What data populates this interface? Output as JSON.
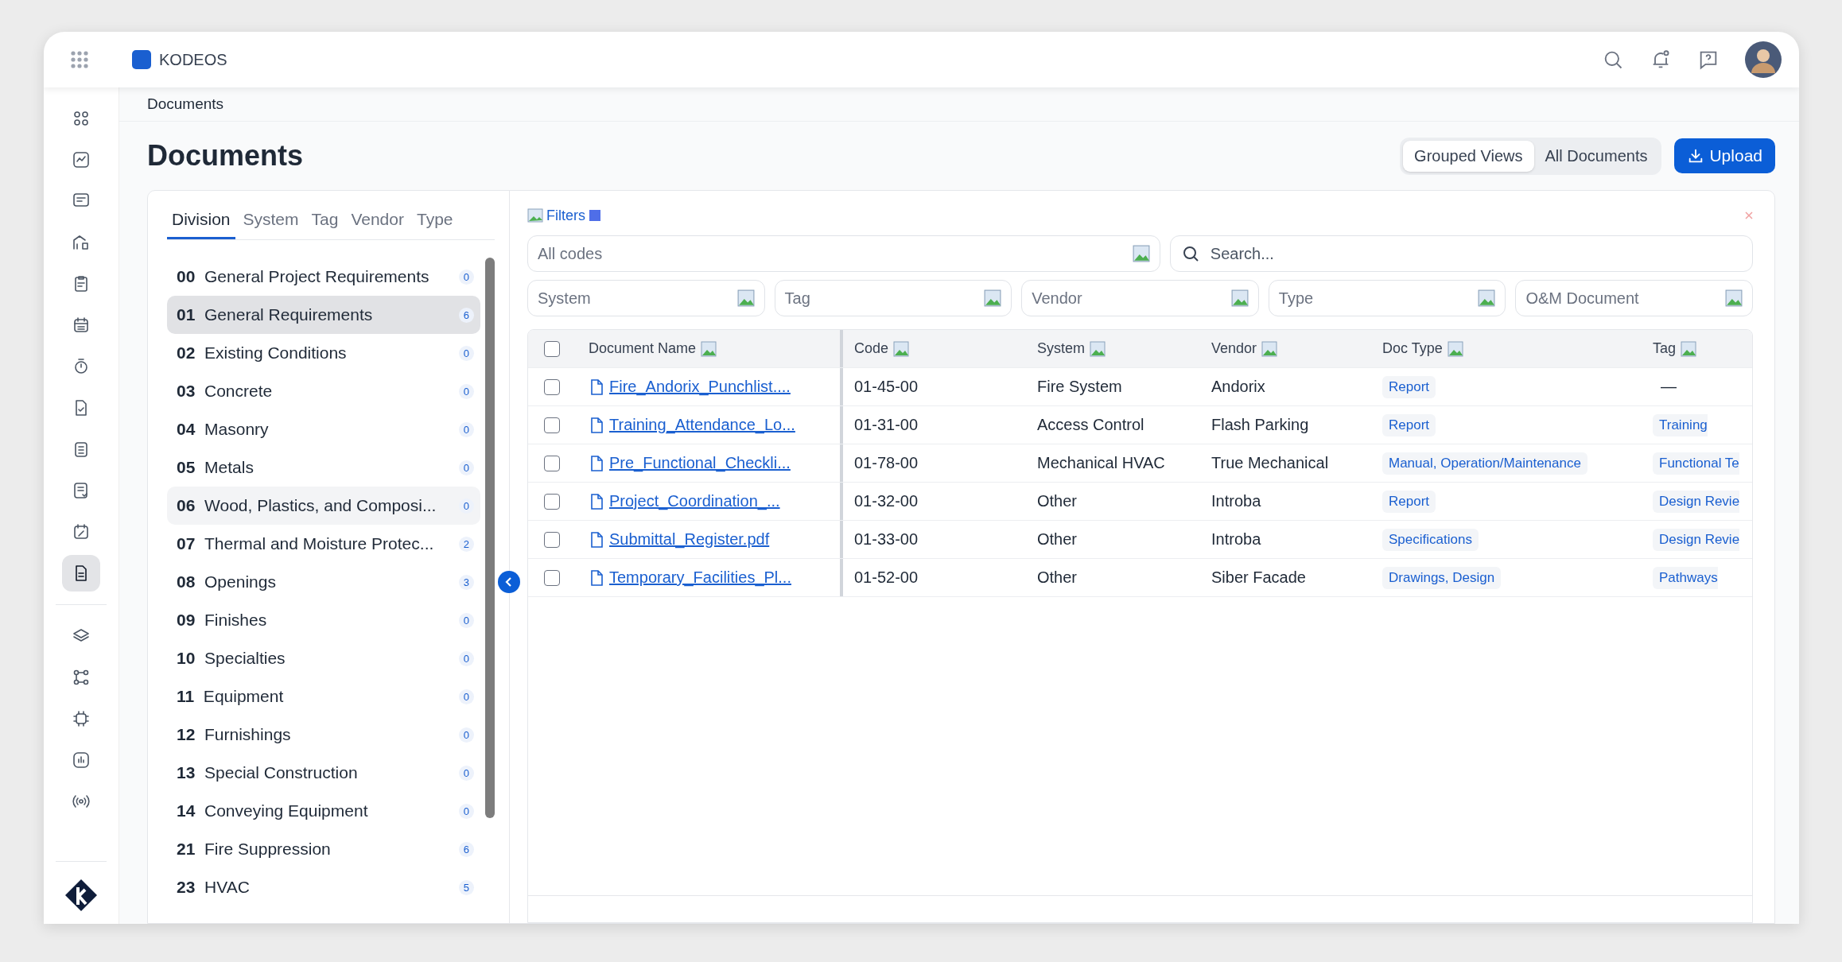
{
  "app": {
    "name": "KODEOS"
  },
  "rail": [
    {
      "kind": "grid",
      "selected": false
    },
    {
      "kind": "chart",
      "selected": false
    },
    {
      "kind": "chat",
      "selected": false
    },
    {
      "kind": "building",
      "selected": false
    },
    {
      "kind": "clipboard",
      "selected": false
    },
    {
      "kind": "calendar",
      "selected": false
    },
    {
      "kind": "timer",
      "selected": false
    },
    {
      "kind": "filecheck",
      "selected": false
    },
    {
      "kind": "list",
      "selected": false
    },
    {
      "kind": "notes",
      "selected": false
    },
    {
      "kind": "caledit",
      "selected": false
    },
    {
      "kind": "document",
      "selected": true
    }
  ],
  "rail_bottom": [
    {
      "kind": "layers",
      "selected": false
    },
    {
      "kind": "nodes",
      "selected": false
    },
    {
      "kind": "chip",
      "selected": false
    },
    {
      "kind": "bars",
      "selected": false
    },
    {
      "kind": "broadcast",
      "selected": false
    }
  ],
  "breadcrumb": "Documents",
  "title": "Documents",
  "view_toggle": [
    {
      "label": "Grouped Views",
      "selected": true
    },
    {
      "label": "All Documents",
      "selected": false
    }
  ],
  "upload": "Upload",
  "division_tabs": [
    {
      "label": "Division",
      "selected": true
    },
    {
      "label": "System",
      "selected": false
    },
    {
      "label": "Tag",
      "selected": false
    },
    {
      "label": "Vendor",
      "selected": false
    },
    {
      "label": "Type",
      "selected": false
    }
  ],
  "divisions": [
    {
      "code": "00",
      "name": "General Project Requirements",
      "count": "0",
      "selected": false,
      "hovered": false
    },
    {
      "code": "01",
      "name": "General Requirements",
      "count": "6",
      "selected": true,
      "hovered": false
    },
    {
      "code": "02",
      "name": "Existing Conditions",
      "count": "0",
      "selected": false,
      "hovered": false
    },
    {
      "code": "03",
      "name": "Concrete",
      "count": "0",
      "selected": false,
      "hovered": false
    },
    {
      "code": "04",
      "name": "Masonry",
      "count": "0",
      "selected": false,
      "hovered": false
    },
    {
      "code": "05",
      "name": "Metals",
      "count": "0",
      "selected": false,
      "hovered": false
    },
    {
      "code": "06",
      "name": "Wood, Plastics, and Composi...",
      "count": "0",
      "selected": false,
      "hovered": true
    },
    {
      "code": "07",
      "name": "Thermal and Moisture Protec...",
      "count": "2",
      "selected": false,
      "hovered": false
    },
    {
      "code": "08",
      "name": "Openings",
      "count": "3",
      "selected": false,
      "hovered": false
    },
    {
      "code": "09",
      "name": "Finishes",
      "count": "0",
      "selected": false,
      "hovered": false
    },
    {
      "code": "10",
      "name": "Specialties",
      "count": "0",
      "selected": false,
      "hovered": false
    },
    {
      "code": "11",
      "name": "Equipment",
      "count": "0",
      "selected": false,
      "hovered": false
    },
    {
      "code": "12",
      "name": "Furnishings",
      "count": "0",
      "selected": false,
      "hovered": false
    },
    {
      "code": "13",
      "name": "Special Construction",
      "count": "0",
      "selected": false,
      "hovered": false
    },
    {
      "code": "14",
      "name": "Conveying Equipment",
      "count": "0",
      "selected": false,
      "hovered": false
    },
    {
      "code": "21",
      "name": "Fire Suppression",
      "count": "6",
      "selected": false,
      "hovered": false
    },
    {
      "code": "23",
      "name": "HVAC",
      "count": "5",
      "selected": false,
      "hovered": false
    }
  ],
  "filters": {
    "label": "Filters",
    "codes_placeholder": "All codes",
    "search_placeholder": "Search...",
    "selects": [
      "System",
      "Tag",
      "Vendor",
      "Type",
      "O&M Document"
    ]
  },
  "table": {
    "all_checked": false,
    "columns": [
      "Document Name",
      "Code",
      "System",
      "Vendor",
      "Doc Type",
      "Tag"
    ],
    "rows": [
      {
        "name": "Fire_Andorix_Punchlist....",
        "code": "01-45-00",
        "system": "Fire System",
        "vendor": "Andorix",
        "doc_type": "Report",
        "tag": {
          "text": "—",
          "kind": "plain"
        },
        "checked": false
      },
      {
        "name": "Training_Attendance_Lo...",
        "code": "01-31-00",
        "system": "Access Control",
        "vendor": "Flash Parking",
        "doc_type": "Report",
        "tag": {
          "text": "Training",
          "kind": "chip"
        },
        "checked": false
      },
      {
        "name": "Pre_Functional_Checkli...",
        "code": "01-78-00",
        "system": "Mechanical HVAC",
        "vendor": "True Mechanical",
        "doc_type": "Manual, Operation/Maintenance",
        "tag": {
          "text": "Functional Te",
          "kind": "chip"
        },
        "checked": false
      },
      {
        "name": "Project_Coordination_...",
        "code": "01-32-00",
        "system": "Other",
        "vendor": "Introba",
        "doc_type": "Report",
        "tag": {
          "text": "Design Revie",
          "kind": "chip"
        },
        "checked": false
      },
      {
        "name": "Submittal_Register.pdf",
        "code": "01-33-00",
        "system": "Other",
        "vendor": "Introba",
        "doc_type": "Specifications",
        "tag": {
          "text": "Design Revie",
          "kind": "chip"
        },
        "checked": false
      },
      {
        "name": "Temporary_Facilities_Pl...",
        "code": "01-52-00",
        "system": "Other",
        "vendor": "Siber Facade",
        "doc_type": "Drawings, Design",
        "tag": {
          "text": "Pathways",
          "kind": "chip"
        },
        "checked": false
      }
    ]
  }
}
